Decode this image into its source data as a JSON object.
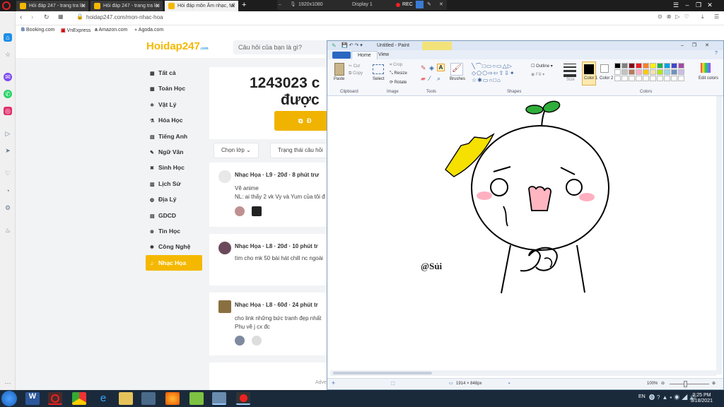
{
  "browser": {
    "tabs": [
      {
        "label": "Hỏi đáp 247 - trang tra lời"
      },
      {
        "label": "Hỏi đáp 247 - trang tra lời"
      },
      {
        "label": "Hỏi đáp môn Âm nhạc, Mĩ"
      }
    ],
    "recorder": {
      "resolution": "1920x1080",
      "display": "Display 1",
      "rec": "REC"
    },
    "url": "hoidap247.com/mon-nhac-hoa",
    "bookmarks": [
      "Booking.com",
      "VnExpress",
      "Amazon.com",
      "Agoda.com"
    ]
  },
  "site": {
    "logo": "Hoidap247",
    "logo_sub": ".com",
    "search_placeholder": "Câu hỏi của bạn là gì?",
    "menu": [
      {
        "label": "Tất cả",
        "icon": "grid-icon"
      },
      {
        "label": "Toán Học",
        "icon": "math-icon"
      },
      {
        "label": "Vật Lý",
        "icon": "atom-icon"
      },
      {
        "label": "Hóa Học",
        "icon": "flask-icon"
      },
      {
        "label": "Tiếng Anh",
        "icon": "language-icon"
      },
      {
        "label": "Ngữ Văn",
        "icon": "pen-icon"
      },
      {
        "label": "Sinh Học",
        "icon": "dna-icon"
      },
      {
        "label": "Lịch Sử",
        "icon": "history-icon"
      },
      {
        "label": "Địa Lý",
        "icon": "globe-icon"
      },
      {
        "label": "GDCD",
        "icon": "book-icon"
      },
      {
        "label": "Tin Học",
        "icon": "computer-icon"
      },
      {
        "label": "Công Nghệ",
        "icon": "gear-icon"
      },
      {
        "label": "Nhạc Họa",
        "icon": "music-icon",
        "active": true
      }
    ],
    "hero_count": "1243023 c",
    "hero_text": "được",
    "hero_button": "Đ",
    "filter_class": "Chọn lớp",
    "filter_status": "Trạng thái câu hỏi",
    "posts": [
      {
        "meta": "Nhạc Họa · L9 · 20đ · 8 phút trư",
        "line1": "Vẽ anime",
        "line2": "NL: ai thấy 2 vk Vy và Yum của tôi đ"
      },
      {
        "meta": "Nhạc Họa · L8 · 20đ · 10 phút tr",
        "line1": "tìm cho mk 50 bài hát chill nc ngoài"
      },
      {
        "meta": "Nhạc Họa · L8 · 60đ · 24 phút tr",
        "line1": "cho link những bức tranh đẹp nhất",
        "line2": "Phụ vẽ j cx đc"
      }
    ],
    "adv": "Adve"
  },
  "paint": {
    "title": "Untitled - Paint",
    "tabs": [
      "Home",
      "View"
    ],
    "groups": [
      "Clipboard",
      "Image",
      "Tools",
      "Shapes",
      "Colors"
    ],
    "tools": {
      "paste": "Paste",
      "cut": "Cut",
      "copy": "Copy",
      "select": "Select",
      "crop": "Crop",
      "resize": "Resize",
      "rotate": "Rotate",
      "brushes": "Brushes",
      "outline": "Outline",
      "fill": "Fill",
      "size": "Size",
      "color1": "Color 1",
      "color2": "Color 2",
      "edit_colors": "Edit colors"
    },
    "drawing_text": "@Sủi",
    "status_size": "1914 × 848px",
    "zoom": "100%"
  },
  "taskbar": {
    "time": "2:25 PM",
    "date": "3/18/2021",
    "lang": "EN"
  }
}
